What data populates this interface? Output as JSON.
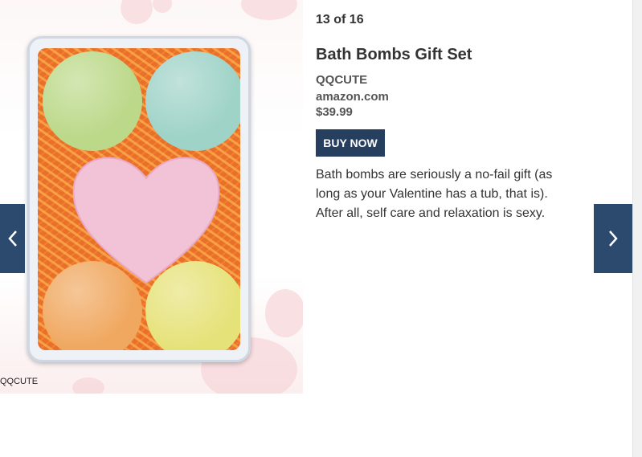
{
  "gallery": {
    "counter": "13 of 16",
    "photo_credit": "QQCUTE"
  },
  "product": {
    "title": "Bath Bombs Gift Set",
    "brand": "QQCUTE",
    "retailer": "amazon.com",
    "price": "$39.99",
    "buy_label": "BUY NOW",
    "description": "Bath bombs are seriously a no-fail gift (as long as your Valentine has a tub, that is). After all, self care and relaxation is sexy."
  },
  "icons": {
    "prev": "chevron-left-icon",
    "next": "chevron-right-icon"
  },
  "colors": {
    "nav_bg": "#2c4a6e",
    "button_bg": "#263f5f",
    "text": "#333333"
  }
}
